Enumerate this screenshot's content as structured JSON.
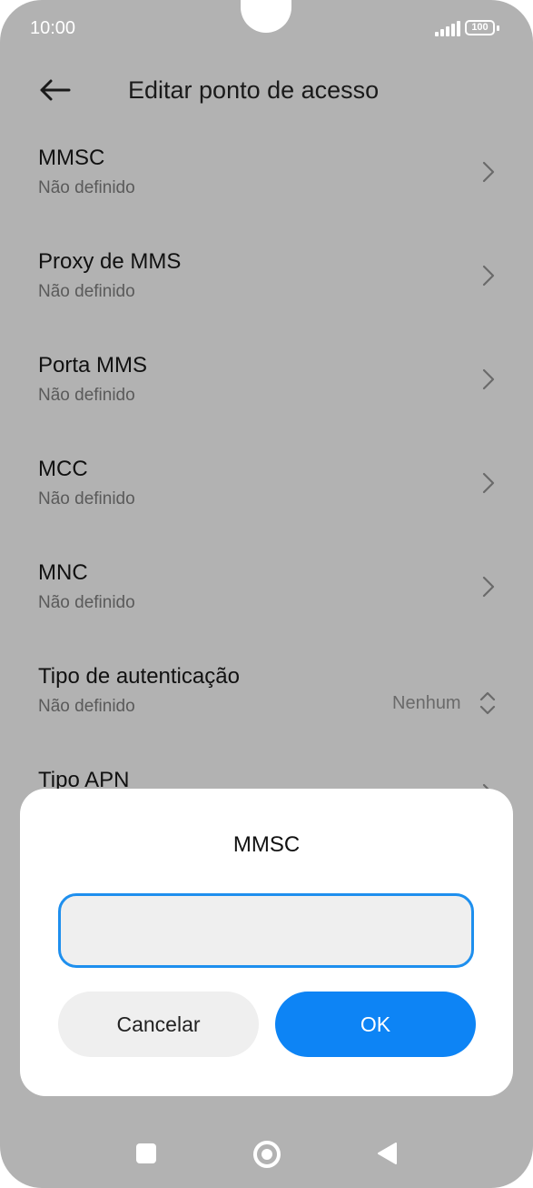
{
  "status_bar": {
    "time": "10:00",
    "battery": "100"
  },
  "header": {
    "title": "Editar ponto de acesso"
  },
  "settings": [
    {
      "title": "MMSC",
      "subtitle": "Não definido"
    },
    {
      "title": "Proxy de MMS",
      "subtitle": "Não definido"
    },
    {
      "title": "Porta MMS",
      "subtitle": "Não definido"
    },
    {
      "title": "MCC",
      "subtitle": "Não definido"
    },
    {
      "title": "MNC",
      "subtitle": "Não definido"
    },
    {
      "title": "Tipo de autenticação",
      "subtitle": "Não definido",
      "value": "Nenhum"
    },
    {
      "title": "Tipo APN"
    }
  ],
  "dialog": {
    "title": "MMSC",
    "input_value": "",
    "cancel_label": "Cancelar",
    "ok_label": "OK"
  },
  "icons": {
    "back": "arrow-left-icon",
    "chevron": "chevron-right-icon",
    "selector": "chevron-up-down-icon",
    "recents": "square-icon",
    "home": "circle-icon",
    "nav_back": "triangle-left-icon"
  },
  "colors": {
    "accent": "#0d84f5",
    "dim_background": "#b2b2b2",
    "focus_border": "#1e8fee"
  }
}
